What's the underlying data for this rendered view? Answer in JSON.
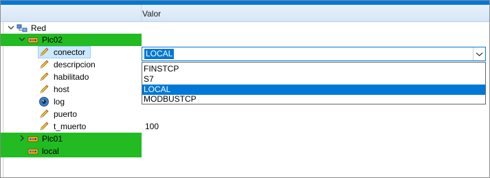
{
  "header": {
    "value_column": "Valor"
  },
  "tree": {
    "root": {
      "label": "Red",
      "expanded": true
    },
    "plc02": {
      "label": "Plc02",
      "expanded": true
    },
    "children": [
      {
        "label": "conector",
        "icon": "pencil-icon",
        "selected": true
      },
      {
        "label": "descripcion",
        "icon": "pencil-icon"
      },
      {
        "label": "habilitado",
        "icon": "pencil-icon"
      },
      {
        "label": "host",
        "icon": "pencil-icon"
      },
      {
        "label": "log",
        "icon": "eye-icon"
      },
      {
        "label": "puerto",
        "icon": "pencil-icon"
      },
      {
        "label": "t_muerto",
        "icon": "pencil-icon",
        "value": "100"
      }
    ],
    "plc01": {
      "label": "Plc01",
      "expanded": false
    },
    "local": {
      "label": "local"
    }
  },
  "combo": {
    "selected_text": "LOCAL",
    "options": [
      "FINSTCP",
      "S7",
      "LOCAL",
      "MODBUSTCP"
    ],
    "selected_index": 2
  },
  "colors": {
    "green_row": "#22bb22",
    "accent": "#0078d7"
  }
}
